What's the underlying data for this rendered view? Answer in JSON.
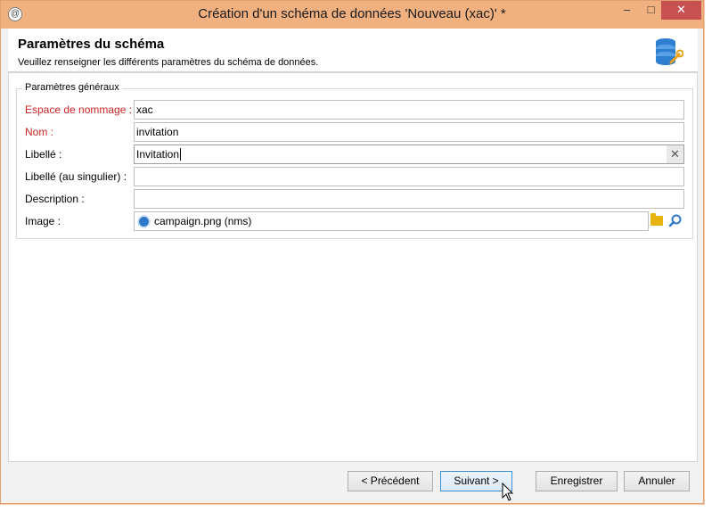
{
  "window": {
    "title": "Création d'un schéma de données 'Nouveau (xac)' *",
    "app_icon_glyph": "@",
    "minimize_glyph": "–",
    "maximize_glyph": "□",
    "close_glyph": "✕",
    "close_color": "#c75050",
    "titlebar_color": "#f0b080"
  },
  "header": {
    "title": "Paramètres du schéma",
    "subtitle": "Veuillez renseigner les différents paramètres du schéma de données.",
    "icon": "database-wrench-icon"
  },
  "group": {
    "legend": "Paramètres généraux",
    "fields": {
      "namespace": {
        "label": "Espace de nommage :",
        "value": "xac",
        "required": true
      },
      "name": {
        "label": "Nom :",
        "value": "invitation",
        "required": true
      },
      "label": {
        "label": "Libellé :",
        "value": "Invitation",
        "required": false
      },
      "label_singular": {
        "label": "Libellé (au singulier) :",
        "value": "",
        "required": false
      },
      "description": {
        "label": "Description :",
        "value": "",
        "required": false
      },
      "image": {
        "label": "Image :",
        "value": "campaign.png (nms)",
        "required": false
      }
    },
    "required_color": "#cc2222"
  },
  "footer": {
    "previous_label": "< Précédent",
    "next_label": "Suivant >",
    "save_label": "Enregistrer",
    "cancel_label": "Annuler"
  }
}
